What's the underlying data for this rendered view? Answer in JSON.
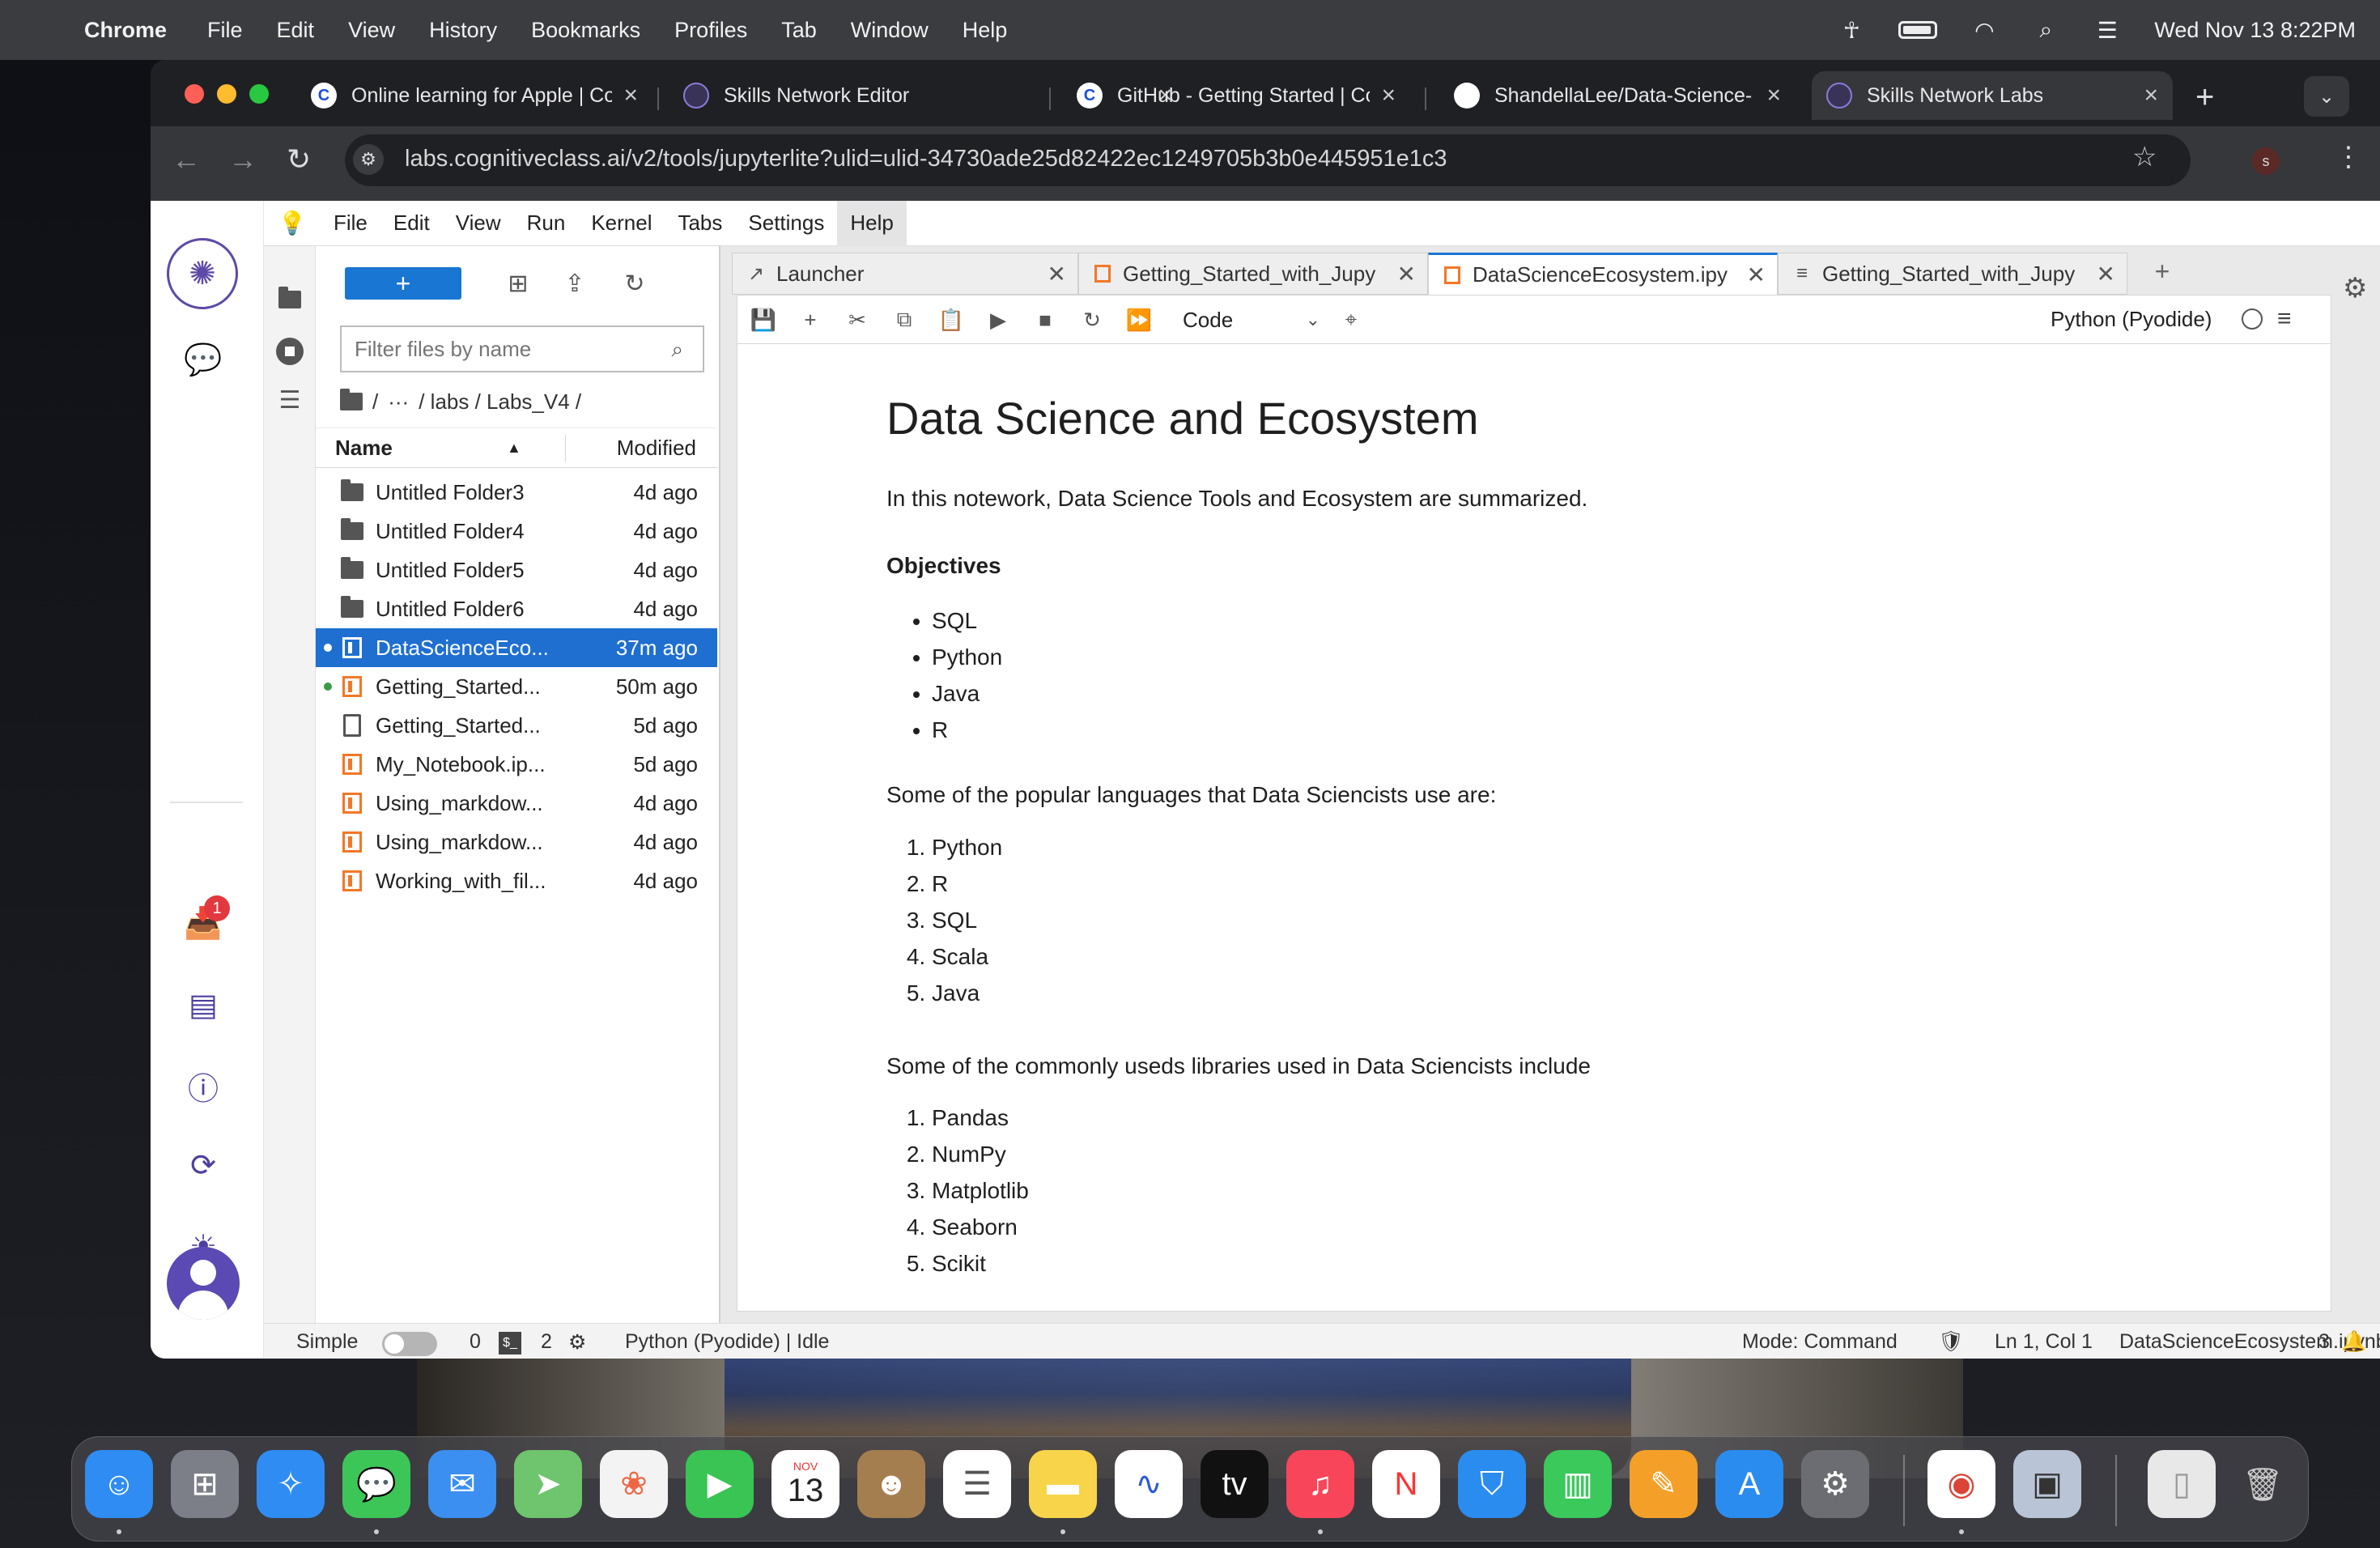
{
  "menubar": {
    "app_name": "Chrome",
    "items": [
      "File",
      "Edit",
      "View",
      "History",
      "Bookmarks",
      "Profiles",
      "Tab",
      "Window",
      "Help"
    ],
    "datetime": "Wed Nov 13  8:22PM"
  },
  "browser": {
    "tabs": [
      {
        "title": "Online learning for Apple | Co",
        "favicon_letter": "C"
      },
      {
        "title": "Skills Network Editor",
        "favicon_letter": ""
      },
      {
        "title": "GitHub - Getting Started | Co",
        "favicon_letter": "C"
      },
      {
        "title": "ShandellaLee/Data-Science-",
        "favicon_letter": ""
      },
      {
        "title": "Skills Network Labs",
        "favicon_letter": ""
      }
    ],
    "url": "labs.cognitiveclass.ai/v2/tools/jupyterlite?ulid=ulid-34730ade25d82422ec1249705b3b0e445951e1c3",
    "profile_initial": "s",
    "new_tab_symbol": "+"
  },
  "rail": {
    "notification_count": "1"
  },
  "jupyter": {
    "menus": [
      "File",
      "Edit",
      "View",
      "Run",
      "Kernel",
      "Tabs",
      "Settings",
      "Help"
    ],
    "new_button_label": "+",
    "filter_placeholder": "Filter files by name",
    "breadcrumbs": [
      "/",
      "···",
      "/ labs / Labs_V4 /"
    ],
    "columns": {
      "name": "Name",
      "modified": "Modified"
    },
    "files": [
      {
        "name": "Untitled Folder3",
        "modified": "4d ago",
        "type": "folder"
      },
      {
        "name": "Untitled Folder4",
        "modified": "4d ago",
        "type": "folder"
      },
      {
        "name": "Untitled Folder5",
        "modified": "4d ago",
        "type": "folder"
      },
      {
        "name": "Untitled Folder6",
        "modified": "4d ago",
        "type": "folder"
      },
      {
        "name": "DataScienceEco...",
        "modified": "37m ago",
        "type": "notebook"
      },
      {
        "name": "Getting_Started...",
        "modified": "50m ago",
        "type": "notebook"
      },
      {
        "name": "Getting_Started...",
        "modified": "5d ago",
        "type": "file"
      },
      {
        "name": "My_Notebook.ip...",
        "modified": "5d ago",
        "type": "notebook"
      },
      {
        "name": "Using_markdow...",
        "modified": "4d ago",
        "type": "notebook"
      },
      {
        "name": "Using_markdow...",
        "modified": "4d ago",
        "type": "notebook"
      },
      {
        "name": "Working_with_fil...",
        "modified": "4d ago",
        "type": "notebook"
      }
    ],
    "doc_tabs": [
      {
        "title": "Launcher"
      },
      {
        "title": "Getting_Started_with_Jupy"
      },
      {
        "title": "DataScienceEcosystem.ipy"
      },
      {
        "title": "Getting_Started_with_Jupy"
      }
    ],
    "cell_type": "Code",
    "kernel": "Python (Pyodide)"
  },
  "notebook": {
    "title": "Data Science and Ecosystem",
    "intro": "In this notework, Data Science Tools and Ecosystem are summarized.",
    "objectives_heading": "Objectives",
    "objectives": [
      "SQL",
      "Python",
      "Java",
      "R"
    ],
    "languages_intro": "Some of the popular languages that Data Sciencists use are:",
    "languages": [
      "Python",
      "R",
      "SQL",
      "Scala",
      "Java"
    ],
    "libraries_intro": "Some of the commonly useds libraries used in Data Sciencists include",
    "libraries": [
      "Pandas",
      "NumPy",
      "Matplotlib",
      "Seaborn",
      "Scikit"
    ]
  },
  "statusbar": {
    "mode_label": "Simple",
    "count_a": "0",
    "count_b": "2",
    "kernel_status": "Python (Pyodide) | Idle",
    "mode": "Mode: Command",
    "position": "Ln 1, Col 1",
    "filename": "DataScienceEcosystem.ipynb",
    "notifications": "3"
  },
  "dock": {
    "calendar_month": "NOV",
    "calendar_day": "13"
  },
  "colors": {
    "accent": "#1976d2",
    "selected_row": "#1f6fd1",
    "brand_purple": "#5d49a8",
    "notebook_orange": "#f37726"
  }
}
